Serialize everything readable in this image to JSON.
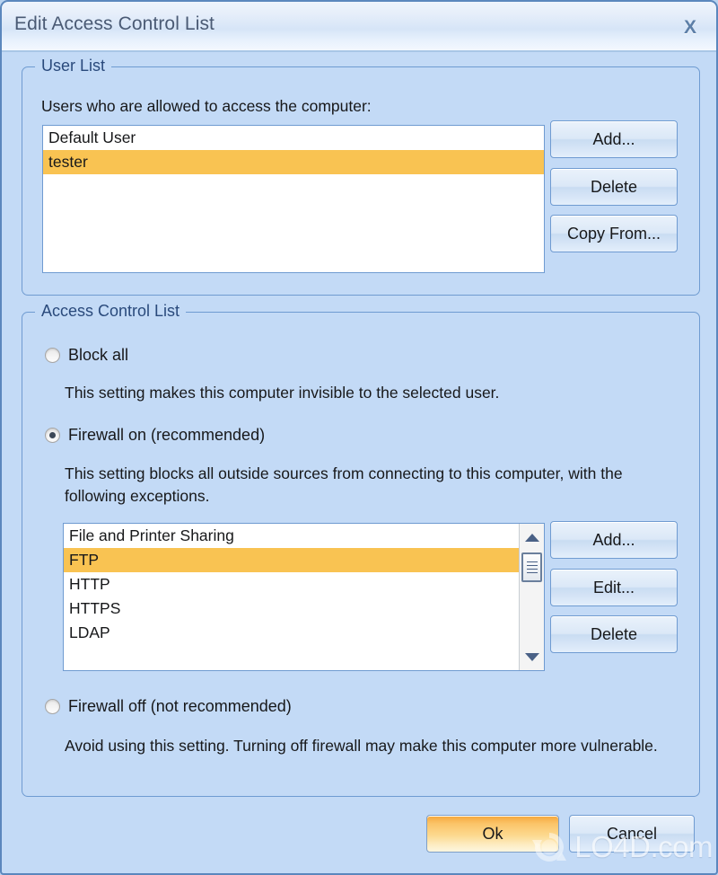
{
  "window": {
    "title": "Edit Access Control List",
    "close_label": "X"
  },
  "user_list_group": {
    "legend": "User List",
    "description": "Users who are allowed to access the computer:",
    "items": [
      {
        "label": "Default User",
        "selected": false
      },
      {
        "label": "tester",
        "selected": true
      }
    ],
    "buttons": [
      {
        "label": "Add..."
      },
      {
        "label": "Delete"
      },
      {
        "label": "Copy From..."
      }
    ]
  },
  "acl_group": {
    "legend": "Access Control List",
    "options": [
      {
        "label": "Block all",
        "checked": false,
        "description": "This setting makes this computer invisible to the selected user."
      },
      {
        "label": "Firewall on (recommended)",
        "checked": true,
        "description": "This setting blocks all outside sources from connecting to this computer, with the following exceptions."
      },
      {
        "label": "Firewall off (not recommended)",
        "checked": false,
        "description": "Avoid using this setting. Turning off firewall may make this computer more vulnerable."
      }
    ],
    "exceptions": {
      "items": [
        {
          "label": "File and Printer Sharing",
          "selected": false
        },
        {
          "label": "FTP",
          "selected": true
        },
        {
          "label": "HTTP",
          "selected": false
        },
        {
          "label": "HTTPS",
          "selected": false
        },
        {
          "label": "LDAP",
          "selected": false
        }
      ],
      "buttons": [
        {
          "label": "Add..."
        },
        {
          "label": "Edit..."
        },
        {
          "label": "Delete"
        }
      ]
    }
  },
  "footer": {
    "ok_label": "Ok",
    "cancel_label": "Cancel"
  },
  "watermark": {
    "text": "LO4D.com"
  },
  "colors": {
    "dialog_background": "#c3daf6",
    "selection_highlight": "#f9c352",
    "group_border": "#6f9bd1",
    "title_text": "#4a5a74",
    "primary_button": "#f5a63a"
  }
}
